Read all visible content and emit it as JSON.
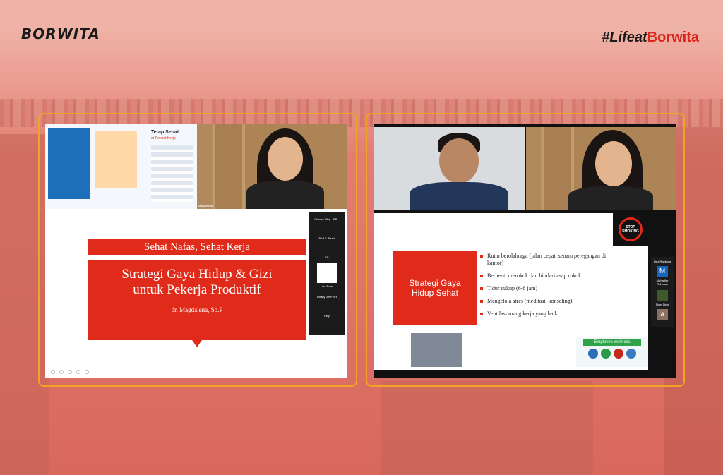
{
  "brand": {
    "logo": "BORWITA",
    "hashtag": "#Lifeat",
    "hashtag_brand": "Borwita"
  },
  "left": {
    "poster_title": "Tetap Sehat",
    "poster_subtitle": "di Tempat Kerja",
    "speaker_name": "Magdalena",
    "participants": [
      "Dhimas Bilqi... BB...",
      "Prof E. Perut",
      "Zik",
      "Liza Romi",
      "Dhany, BKP SH",
      "Fitty"
    ],
    "slide": {
      "header": "Sehat Nafas, Sehat Kerja",
      "title_line1": "Strategi Gaya Hidup & Gizi",
      "title_line2": "untuk Pekerja Produktif",
      "presenter": "dr. Magdalena, Sp.P"
    }
  },
  "right": {
    "slide": {
      "box_line1": "Strategi Gaya",
      "box_line2": "Hidup Sehat",
      "stop_line1": "STOP",
      "stop_line2": "SMOKING",
      "bullets": [
        "Rutin berolahraga (jalan cepat, senam peregangan di kantor)",
        "Berhenti merokok dan hindari asap rokok",
        "Tidur cukup (6-8 jam)",
        "Mengelola stres (meditasi, konseling)",
        "Ventilasi ruang kerja yang baik"
      ],
      "wellness_title": "Employee wellness"
    },
    "participants": [
      "Lina Risdiana",
      "M",
      "Muhadhir Rahman",
      "Noer Dion",
      "a"
    ]
  },
  "colors": {
    "accent": "#e12b1a",
    "frame": "#f2a224",
    "brand_red": "#d9261c"
  }
}
